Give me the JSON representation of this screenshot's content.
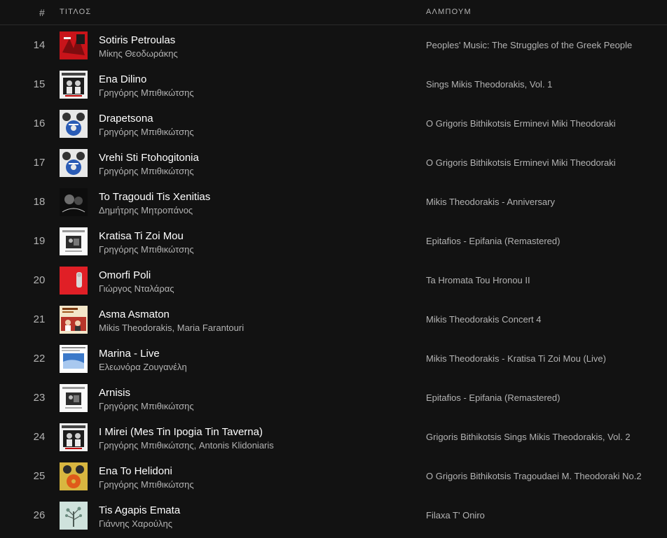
{
  "header": {
    "number_label": "#",
    "title_label": "ΤΙΤΛΟΣ",
    "album_label": "ΑΛΜΠΟΥΜ"
  },
  "tracks": [
    {
      "number": "14",
      "title": "Sotiris Petroulas",
      "artist": "Μίκης Θεοδωράκης",
      "album": "Peoples' Music: The Struggles of the Greek People",
      "cover": "red-cover-icon"
    },
    {
      "number": "15",
      "title": "Ena Dilino",
      "artist": "Γρηγόρης Μπιθικώτσης",
      "album": "Sings Mikis Theodorakis, Vol. 1",
      "cover": "bw-portrait-cover-icon"
    },
    {
      "number": "16",
      "title": "Drapetsona",
      "artist": "Γρηγόρης Μπιθικώτσης",
      "album": "O Grigoris Bithikotsis Erminevi Miki Theodoraki",
      "cover": "blue-label-cover-icon"
    },
    {
      "number": "17",
      "title": "Vrehi Sti Ftohogitonia",
      "artist": "Γρηγόρης Μπιθικώτσης",
      "album": "O Grigoris Bithikotsis Erminevi Miki Theodoraki",
      "cover": "blue-label-cover-icon"
    },
    {
      "number": "18",
      "title": "To Tragoudi Tis Xenitias",
      "artist": "Δημήτρης Μητροπάνος",
      "album": "Mikis Theodorakis - Anniversary",
      "cover": "dark-portrait-cover-icon"
    },
    {
      "number": "19",
      "title": "Kratisa Ti Zoi Mou",
      "artist": "Γρηγόρης Μπιθικώτσης",
      "album": "Epitafios - Epifania (Remastered)",
      "cover": "white-photo-cover-icon"
    },
    {
      "number": "20",
      "title": "Omorfi Poli",
      "artist": "Γιώργος Νταλάρας",
      "album": "Ta Hromata Tou Hronou II",
      "cover": "red-figure-cover-icon"
    },
    {
      "number": "21",
      "title": "Asma Asmaton",
      "artist": "Mikis Theodorakis, Maria Farantouri",
      "album": "Mikis Theodorakis Concert 4",
      "cover": "concert-cover-icon"
    },
    {
      "number": "22",
      "title": "Marina - Live",
      "artist": "Ελεωνόρα Ζουγανέλη",
      "album": "Mikis Theodorakis - Kratisa Ti Zoi Mou (Live)",
      "cover": "blue-sea-cover-icon"
    },
    {
      "number": "23",
      "title": "Arnisis",
      "artist": "Γρηγόρης Μπιθικώτσης",
      "album": "Epitafios - Epifania (Remastered)",
      "cover": "white-photo-cover-icon"
    },
    {
      "number": "24",
      "title": "I Mirei (Mes Tin Ipogia Tin Taverna)",
      "artist": "Γρηγόρης Μπιθικώτσης, Antonis Klidoniaris",
      "album": "Grigoris Bithikotsis Sings Mikis Theodorakis, Vol. 2",
      "cover": "bw-portrait-cover-icon"
    },
    {
      "number": "25",
      "title": "Ena To Helidoni",
      "artist": "Γρηγόρης Μπιθικώτσης",
      "album": "O Grigoris Bithikotsis Tragoudaei M. Theodoraki No.2",
      "cover": "yellow-label-cover-icon"
    },
    {
      "number": "26",
      "title": "Tis Agapis Emata",
      "artist": "Γιάννης Χαρούλης",
      "album": "Filaxa T' Oniro",
      "cover": "tree-cover-icon"
    }
  ]
}
